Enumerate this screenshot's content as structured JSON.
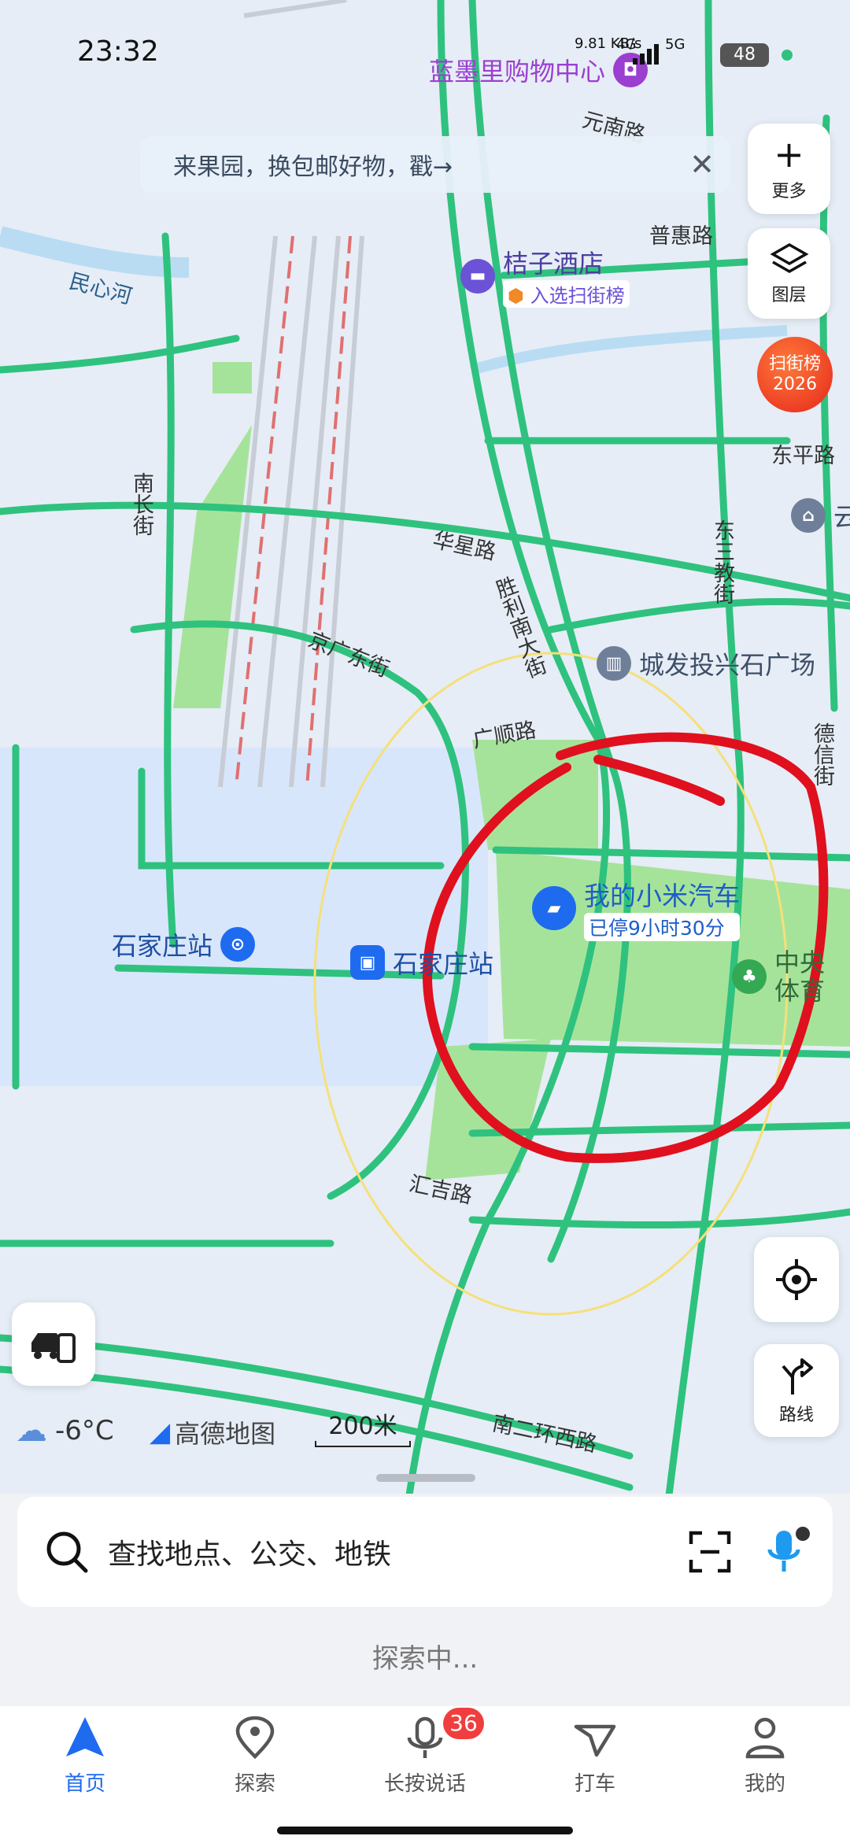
{
  "status_bar": {
    "time": "23:32",
    "network_speed": "9.81 KB/s",
    "network_type_1": "4G",
    "network_type_2": "5G",
    "battery": "48"
  },
  "banner": {
    "text": "来果园，换包邮好物，戳→"
  },
  "map_controls": {
    "more_label": "更多",
    "layers_label": "图层",
    "scan_ranking_label_1": "扫街榜",
    "scan_ranking_label_2": "2026",
    "locate_icon": "crosshair-icon",
    "route_label": "路线"
  },
  "map": {
    "scale": "200米",
    "weather_temp": "-6°C",
    "brand": "高德地图",
    "pois": {
      "mall": "蓝墨里购物中心",
      "hotel": "桔子酒店",
      "hotel_tag": "入选扫街榜",
      "plaza": "城发投兴石广场",
      "car": "我的小米汽车",
      "car_status": "已停9小时30分",
      "station1": "石家庄站",
      "station2": "石家庄站",
      "sports_1": "中央",
      "sports_2": "体育",
      "yun": "云"
    },
    "roads": {
      "minxin_river": "民心河",
      "puhui": "普惠路",
      "yuannan": "元南路",
      "dongping": "东平路",
      "nanchang": "南长街",
      "huaxing": "华星路",
      "shengli": "胜利南大街",
      "jingguang": "京广东街",
      "guangshun": "广顺路",
      "huiji": "汇吉路",
      "dongsan": "东三教街",
      "dexin": "德信街",
      "nanerhuan": "南二环西路"
    }
  },
  "search": {
    "placeholder": "查找地点、公交、地铁",
    "exploring_text": "探索中..."
  },
  "tabs": [
    {
      "label": "首页",
      "icon": "navigation-arrow-icon"
    },
    {
      "label": "探索",
      "icon": "location-pin-icon"
    },
    {
      "label": "长按说话",
      "icon": "microphone-icon",
      "badge": "36"
    },
    {
      "label": "打车",
      "icon": "taxi-arrow-icon"
    },
    {
      "label": "我的",
      "icon": "person-icon"
    }
  ],
  "colors": {
    "road_green": "#2ec27e",
    "accent_blue": "#1e6bf0",
    "annotation_red": "#e0101e"
  }
}
